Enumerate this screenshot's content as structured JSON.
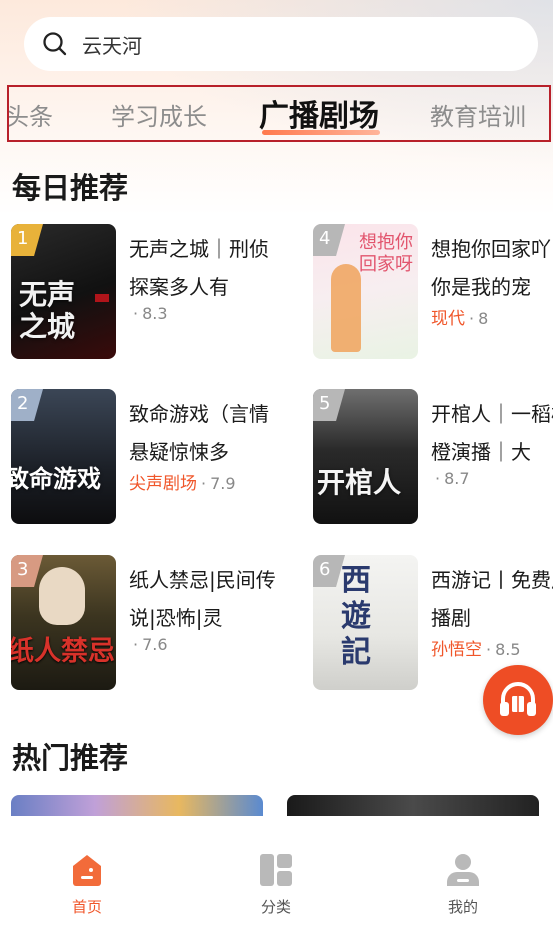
{
  "search": {
    "value": "云天河",
    "icon": "search-icon"
  },
  "tabs": [
    {
      "label": "头条",
      "active": false
    },
    {
      "label": "学习成长",
      "active": false
    },
    {
      "label": "广播剧场",
      "active": true
    },
    {
      "label": "教育培训",
      "active": false
    }
  ],
  "daily": {
    "title": "每日推荐",
    "items": [
      {
        "rank": "1",
        "title": "无声之城｜刑侦探案多人有",
        "tag": "",
        "dot": "·",
        "score": "8.3",
        "cover_text": "无声之城"
      },
      {
        "rank": "4",
        "title": "想抱你回家吖 | 你是我的宠",
        "tag": "现代",
        "dot": "·",
        "score": "8",
        "cover_text": "想抱你回家呀"
      },
      {
        "rank": "2",
        "title": "致命游戏（言情悬疑惊悚多",
        "tag": "尖声剧场",
        "dot": "·",
        "score": "7.9",
        "cover_text": "致命游戏"
      },
      {
        "rank": "5",
        "title": "开棺人｜一稻橙橙演播｜大",
        "tag": "",
        "dot": "·",
        "score": "8.7",
        "cover_text": "开棺人"
      },
      {
        "rank": "3",
        "title": "纸人禁忌|民间传说|恐怖|灵",
        "tag": "",
        "dot": "·",
        "score": "7.6",
        "cover_text": "纸人禁忌"
      },
      {
        "rank": "6",
        "title": "西游记丨免费广播剧",
        "tag": "孙悟空",
        "dot": "·",
        "score": "8.5",
        "cover_text": "西遊記"
      }
    ]
  },
  "hot": {
    "title": "热门推荐"
  },
  "bottom_nav": [
    {
      "label": "首页",
      "icon": "home-icon",
      "active": true
    },
    {
      "label": "分类",
      "icon": "category-icon",
      "active": false
    },
    {
      "label": "我的",
      "icon": "profile-icon",
      "active": false
    }
  ],
  "colors": {
    "accent": "#f0562a",
    "tab_box": "#b8202a"
  }
}
